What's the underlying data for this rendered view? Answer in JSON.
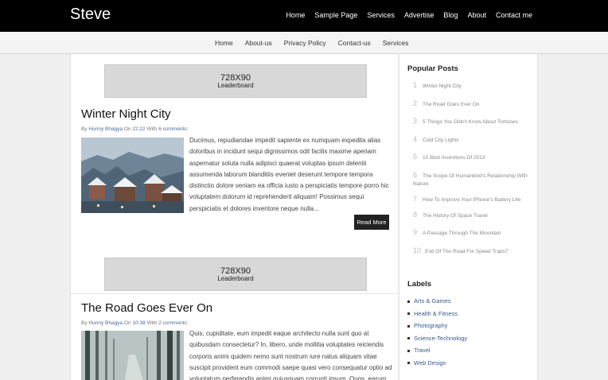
{
  "header": {
    "site_title": "Steve",
    "nav": [
      "Home",
      "Sample Page",
      "Services",
      "Advertise",
      "Blog",
      "About",
      "Contact me"
    ]
  },
  "subnav": [
    "Home",
    "About-us",
    "Privacy Policy",
    "Contact-us",
    "Services"
  ],
  "ads": [
    {
      "size": "728X90",
      "label": "Leaderboard"
    },
    {
      "size": "728X90",
      "label": "Leaderboard"
    }
  ],
  "posts": [
    {
      "title": "Winter Night City",
      "meta": {
        "by": "By",
        "author": "Hunny Bhagya",
        "on": "On",
        "time": "22:22",
        "with": "With",
        "comments": "6 comments:"
      },
      "excerpt": "Ducimus, repudiandae impedit sapiente ex numquam expedita alias doloribus in incidunt sequi dignissimos odit facilis maxime aperiam aspernatur soluta nulla adipisci quaerat voluptas ipsum deleniti assumenda laborum blanditiis eveniet deserunt tempore tempora distinctio dolore veniam ea officia iusto a perspiciatis tempore porro hic voluptatem dolorum id reprehenderit aliquam! Possimus sequi perspiciatis et dolores inventore neque nulla...",
      "read_more": "Read More"
    },
    {
      "title": "The Road Goes Ever On",
      "meta": {
        "by": "By",
        "author": "Hunny Bhagya",
        "on": "On",
        "time": "10:38",
        "with": "With",
        "comments": "2 comments:"
      },
      "excerpt": "Quis, cupiditate, eum impedit eaque architecto nulla sunt quo at quibusdam consectetur? In, libero, unde mollitia voluptates reiciendis corporis animi quidem nemo sunt nostrum iure natus aliquam vitae suscipit provident eum commodi saepe quasi vero consequatur optio ad voluptatum perferendis animi quiusquam corrupti ipsum. Quos, earum"
    }
  ],
  "sidebar": {
    "popular_title": "Popular Posts",
    "popular": [
      {
        "num": "1",
        "title": "Winter Night City"
      },
      {
        "num": "2",
        "title": "The Road Goes Ever On"
      },
      {
        "num": "3",
        "title": "5 Things You Didn't Know About Tortoises"
      },
      {
        "num": "4",
        "title": "Cold City Lights"
      },
      {
        "num": "5",
        "title": "10 Best Inventions Of 2013"
      },
      {
        "num": "6",
        "title": "The Scope Of Humankind's Relationship With Nature"
      },
      {
        "num": "7",
        "title": "How To Improve Your IPhone's Battery Life"
      },
      {
        "num": "8",
        "title": "The History Of Space Travel"
      },
      {
        "num": "9",
        "title": "A Passage Through The Mountain"
      },
      {
        "num": "10",
        "title": "End Of The Road For Speed Traps?"
      }
    ],
    "labels_title": "Labels",
    "labels": [
      "Arts & Games",
      "Health & Fitness",
      "Photography",
      "Science-Technology",
      "Travel",
      "Web Design"
    ]
  }
}
